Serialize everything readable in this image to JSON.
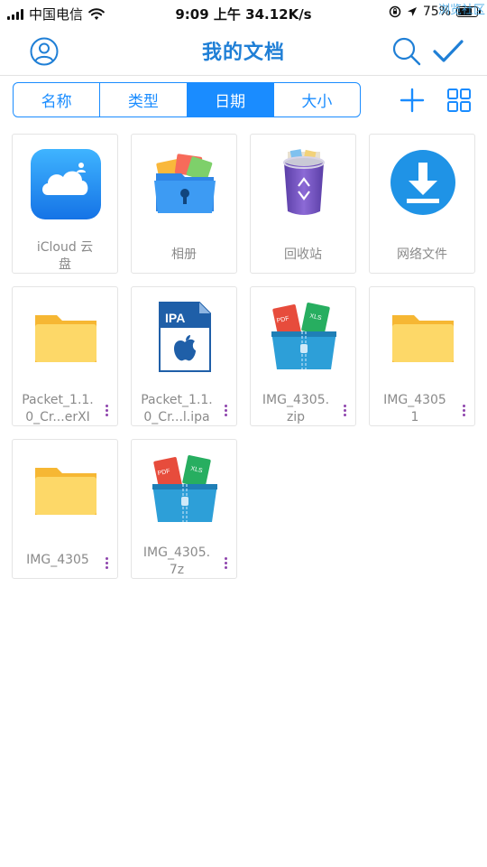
{
  "status_bar": {
    "carrier": "中国电信",
    "time": "9:09 上午 34.12K/s",
    "battery": "75%",
    "battery_level": 0.75,
    "watermark": "浏览社区"
  },
  "nav": {
    "title": "我的文档"
  },
  "sort_tabs": [
    {
      "label": "名称",
      "active": false
    },
    {
      "label": "类型",
      "active": false
    },
    {
      "label": "日期",
      "active": true
    },
    {
      "label": "大小",
      "active": false
    }
  ],
  "files": [
    {
      "name": "iCloud 云\n盘",
      "icon": "icloud-icon",
      "has_more": false
    },
    {
      "name": "相册",
      "icon": "photo-album-icon",
      "has_more": false
    },
    {
      "name": "回收站",
      "icon": "recycle-bin-icon",
      "has_more": false
    },
    {
      "name": "网络文件",
      "icon": "download-icon",
      "has_more": false
    },
    {
      "name": "Packet_1.1.\n0_Cr...erXI",
      "icon": "folder-icon",
      "has_more": true
    },
    {
      "name": "Packet_1.1.\n0_Cr...l.ipa",
      "icon": "ipa-file-icon",
      "has_more": true
    },
    {
      "name": "IMG_4305.\nzip",
      "icon": "archive-icon",
      "has_more": true
    },
    {
      "name": "IMG_4305\n1",
      "icon": "folder-icon",
      "has_more": true
    },
    {
      "name": "IMG_4305",
      "icon": "folder-icon",
      "has_more": true
    },
    {
      "name": "IMG_4305.\n7z",
      "icon": "archive-icon",
      "has_more": true
    }
  ],
  "colors": {
    "accent": "#1a8cff",
    "title": "#1f7fd6",
    "folder": "#fcd462",
    "more_dots": "#8e44ad"
  }
}
